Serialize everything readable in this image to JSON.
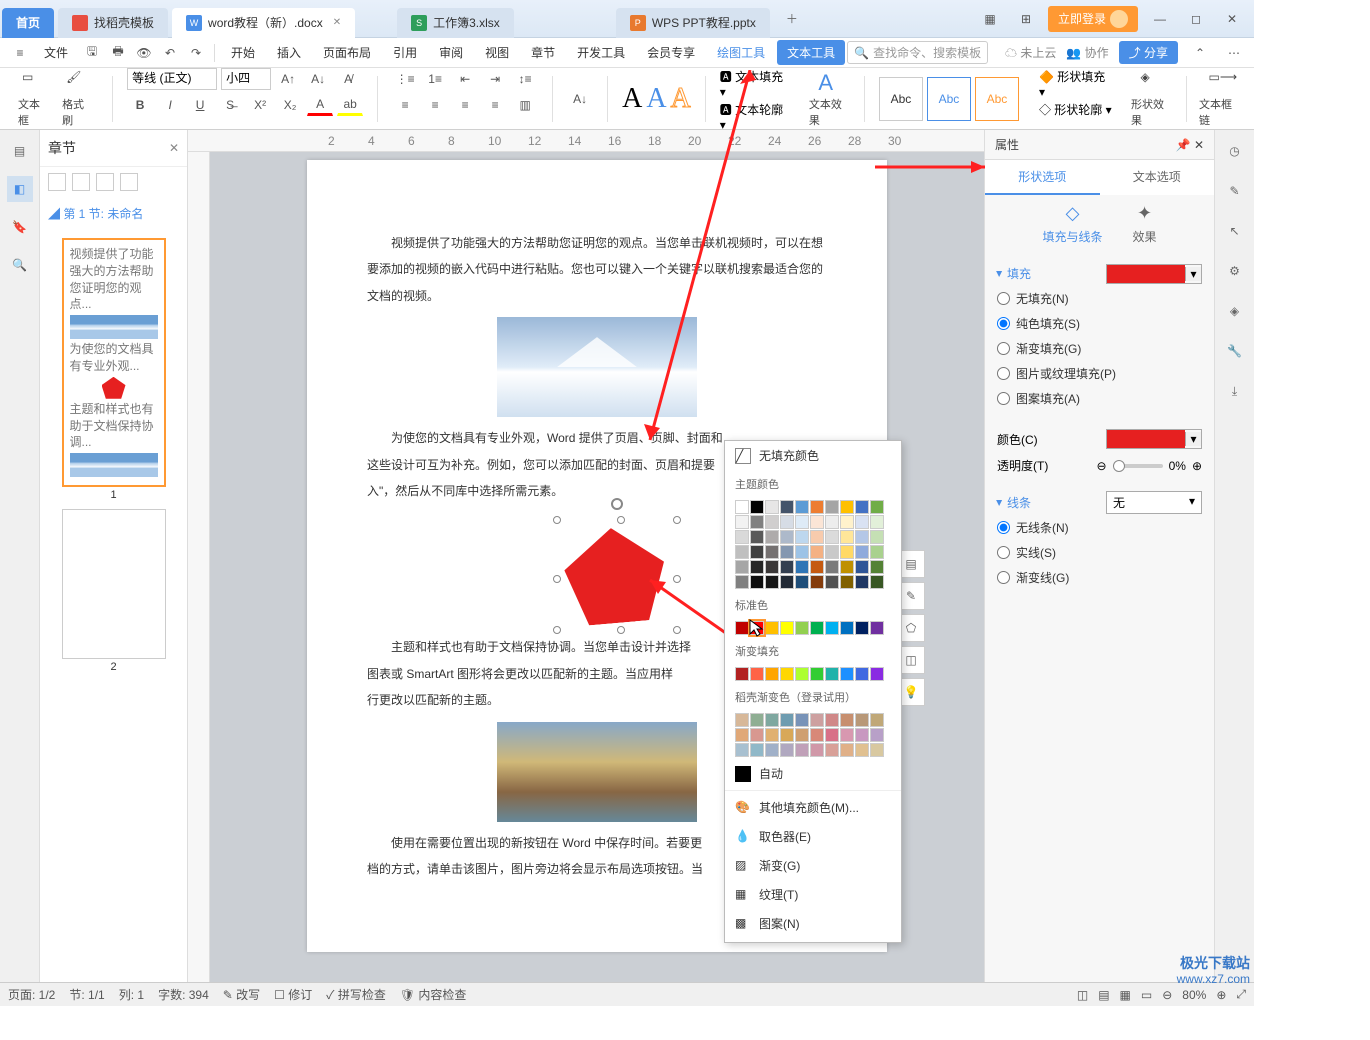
{
  "titlebar": {
    "home": "首页",
    "tabs": [
      {
        "iconColor": "#e84e40",
        "label": "找稻壳模板"
      },
      {
        "iconColor": "#4a8fe7",
        "label": "word教程（新）.docx",
        "active": true
      },
      {
        "iconColor": "#2e9e5b",
        "label": "工作簿3.xlsx"
      },
      {
        "iconColor": "#e8792e",
        "label": "WPS PPT教程.pptx"
      }
    ],
    "login": "立即登录"
  },
  "menubar": {
    "file": "文件",
    "items": [
      "开始",
      "插入",
      "页面布局",
      "引用",
      "审阅",
      "视图",
      "章节",
      "开发工具",
      "会员专享"
    ],
    "drawingTools": "绘图工具",
    "textTools": "文本工具",
    "searchPlaceholder": "查找命令、搜索模板",
    "cloud": "未上云",
    "collab": "协作",
    "share": "分享"
  },
  "toolbar": {
    "textbox": "文本框",
    "formatPainter": "格式刷",
    "fontName": "等线 (正文)",
    "fontSize": "小四",
    "shapeFill": "形状填充",
    "shapeOutline": "形状轮廓",
    "textFill": "文本填充",
    "textOutline": "文本轮廓",
    "textEffect": "文本效果",
    "styleBoxes": [
      "Abc",
      "Abc",
      "Abc"
    ],
    "insertShapeFill": "形状填充",
    "insertShapeOutline": "形状轮廓",
    "shapeEffect": "形状效果",
    "textBoxLink": "文本框链"
  },
  "nav": {
    "title": "章节",
    "section": "第 1 节: 未命名",
    "thumbLabels": [
      "1",
      "2"
    ]
  },
  "document": {
    "para1": "视频提供了功能强大的方法帮助您证明您的观点。当您单击联机视频时，可以在想要添加的视频的嵌入代码中进行粘贴。您也可以键入一个关键字以联机搜索最适合您的文档的视频。",
    "para2": "为使您的文档具有专业外观，Word 提供了页眉、页脚、封面和",
    "para2b": "这些设计可互为补充。例如，您可以添加匹配的封面、页眉和提要",
    "para2c": "入\"，然后从不同库中选择所需元素。",
    "para3": "主题和样式也有助于文档保持协调。当您单击设计并选择",
    "para3b": "图表或 SmartArt 图形将会更改以匹配新的主题。当应用样",
    "para3c": "行更改以匹配新的主题。",
    "para4": "使用在需要位置出现的新按钮在 Word 中保存时间。若要更",
    "para4b": "档的方式，请单击该图片，图片旁边将会显示布局选项按钮。当"
  },
  "colorPopup": {
    "noFill": "无填充颜色",
    "themeColors": "主题颜色",
    "standardColors": "标准色",
    "gradientFill": "渐变填充",
    "daoKe": "稻壳渐变色（登录试用）",
    "auto": "自动",
    "moreColors": "其他填充颜色(M)...",
    "eyedropper": "取色器(E)",
    "gradient": "渐变(G)",
    "texture": "纹理(T)",
    "pattern": "图案(N)",
    "theme_row1": [
      "#ffffff",
      "#000000",
      "#e7e6e6",
      "#44546a",
      "#5b9bd5",
      "#ed7d31",
      "#a5a5a5",
      "#ffc000",
      "#4472c4",
      "#70ad47"
    ],
    "theme_shades": [
      [
        "#f2f2f2",
        "#808080",
        "#d0cece",
        "#d6dce5",
        "#deebf7",
        "#fbe5d6",
        "#ededed",
        "#fff2cc",
        "#d9e2f3",
        "#e2f0d9"
      ],
      [
        "#d9d9d9",
        "#595959",
        "#aeabab",
        "#adb9ca",
        "#bdd7ee",
        "#f8cbad",
        "#dbdbdb",
        "#ffe699",
        "#b4c7e7",
        "#c5e0b4"
      ],
      [
        "#bfbfbf",
        "#404040",
        "#757171",
        "#8497b0",
        "#9dc3e6",
        "#f4b183",
        "#c9c9c9",
        "#ffd966",
        "#8faadc",
        "#a9d18e"
      ],
      [
        "#a6a6a6",
        "#262626",
        "#3b3838",
        "#333f50",
        "#2e75b6",
        "#c55a11",
        "#7b7b7b",
        "#bf9000",
        "#2f5597",
        "#548235"
      ],
      [
        "#808080",
        "#0d0d0d",
        "#171717",
        "#222a35",
        "#1f4e79",
        "#843c0c",
        "#525252",
        "#806000",
        "#203864",
        "#385724"
      ]
    ],
    "standard": [
      "#c00000",
      "#ff0000",
      "#ffc000",
      "#ffff00",
      "#92d050",
      "#00b050",
      "#00b0f0",
      "#0070c0",
      "#002060",
      "#7030a0"
    ],
    "gradient_row": [
      "#b22222",
      "#ff6347",
      "#ffa500",
      "#ffd700",
      "#adff2f",
      "#32cd32",
      "#20b2aa",
      "#1e90ff",
      "#4169e1",
      "#8a2be2"
    ],
    "daoke1": [
      "#d7b899",
      "#8fae93",
      "#7fa8a0",
      "#6e9cb0",
      "#7893b8",
      "#cda0a0",
      "#d08888",
      "#c78f6f",
      "#b89878",
      "#c0a878"
    ],
    "daoke2": [
      "#e0a878",
      "#d89890",
      "#e0b070",
      "#d8a858",
      "#cf9f70",
      "#d88878",
      "#d87088",
      "#d898b0",
      "#c898c0",
      "#b8a0c8"
    ],
    "daoke3": [
      "#a8c0d0",
      "#90b8c8",
      "#a0b0c8",
      "#b0a8c0",
      "#c0a0b8",
      "#d098a8",
      "#d8a098",
      "#e0b088",
      "#e0c090",
      "#d8c8a0"
    ]
  },
  "props": {
    "title": "属性",
    "tabShape": "形状选项",
    "tabText": "文本选项",
    "fillLine": "填充与线条",
    "effect": "效果",
    "fillSection": "填充",
    "radios": [
      "无填充(N)",
      "纯色填充(S)",
      "渐变填充(G)",
      "图片或纹理填充(P)",
      "图案填充(A)"
    ],
    "radioChecked": 1,
    "colorLabel": "颜色(C)",
    "opacityLabel": "透明度(T)",
    "opacityValue": "0%",
    "lineSection": "线条",
    "lineRadios": [
      "无线条(N)",
      "实线(S)",
      "渐变线(G)"
    ],
    "lineChecked": 0,
    "lineDropdown": "无"
  },
  "status": {
    "page": "页面: 1/2",
    "section": "节: 1/1",
    "col": "列: 1",
    "words": "字数: 394",
    "track": "改写",
    "revise": "修订",
    "spell": "拼写检查",
    "content": "内容检查",
    "zoom": "80%"
  },
  "watermark": {
    "line1": "极光下载站",
    "line2": "www.xz7.com"
  }
}
